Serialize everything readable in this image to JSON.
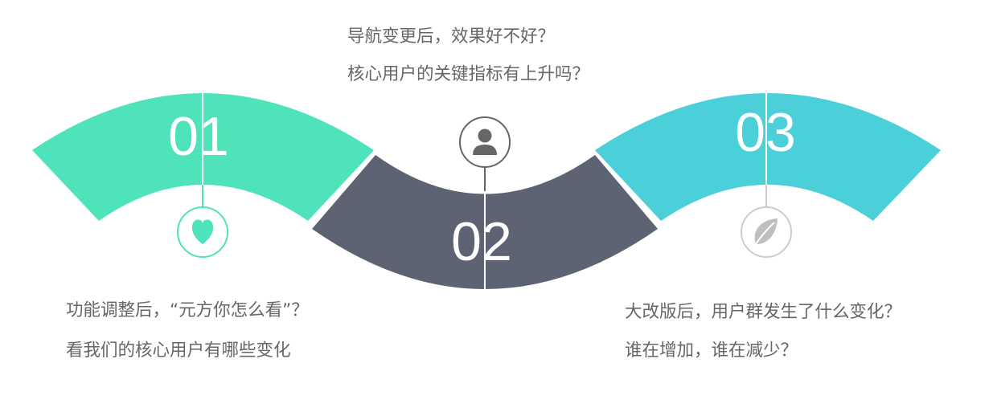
{
  "colors": {
    "step1": "#4fe3bb",
    "step2": "#5d6373",
    "step3": "#4bcfd8",
    "icon2": "#666666",
    "icon3": "#bfbfbf",
    "text": "#666666"
  },
  "steps": [
    {
      "number": "01",
      "icon": "heart-icon",
      "lines": [
        "功能调整后，“元方你怎么看”？",
        "看我们的核心用户有哪些变化"
      ]
    },
    {
      "number": "02",
      "icon": "user-icon",
      "lines": [
        "导航变更后，效果好不好？",
        "核心用户的关键指标有上升吗？"
      ]
    },
    {
      "number": "03",
      "icon": "leaf-icon",
      "lines": [
        "大改版后，用户群发生了什么变化？",
        "谁在增加，谁在减少？"
      ]
    }
  ]
}
